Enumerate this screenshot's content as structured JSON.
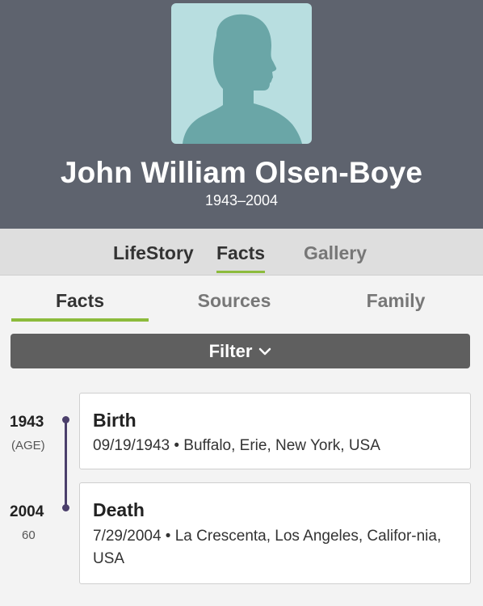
{
  "profile": {
    "name": "John William Olsen-Boye",
    "lifespan": "1943–2004"
  },
  "top_tabs": [
    {
      "label": "LifeStory",
      "active": false
    },
    {
      "label": "Facts",
      "active": true
    },
    {
      "label": "Gallery",
      "active": false
    }
  ],
  "sub_tabs": [
    {
      "label": "Facts",
      "active": true
    },
    {
      "label": "Sources",
      "active": false
    },
    {
      "label": "Family",
      "active": false
    }
  ],
  "filter": {
    "label": "Filter",
    "icon": "chevron-down-icon"
  },
  "events": [
    {
      "year": "1943",
      "age": "(AGE)",
      "title": "Birth",
      "detail": "09/19/1943 • Buffalo, Erie, New York, USA"
    },
    {
      "year": "2004",
      "age": "60",
      "title": "Death",
      "detail": "7/29/2004 • La Crescenta, Los Angeles, Califor-nia, USA"
    }
  ],
  "colors": {
    "header_bg": "#5e636e",
    "avatar_bg": "#b8dee0",
    "silhouette": "#6aa6a7",
    "accent": "#8cbb3c",
    "timeline": "#4b3f6b"
  }
}
